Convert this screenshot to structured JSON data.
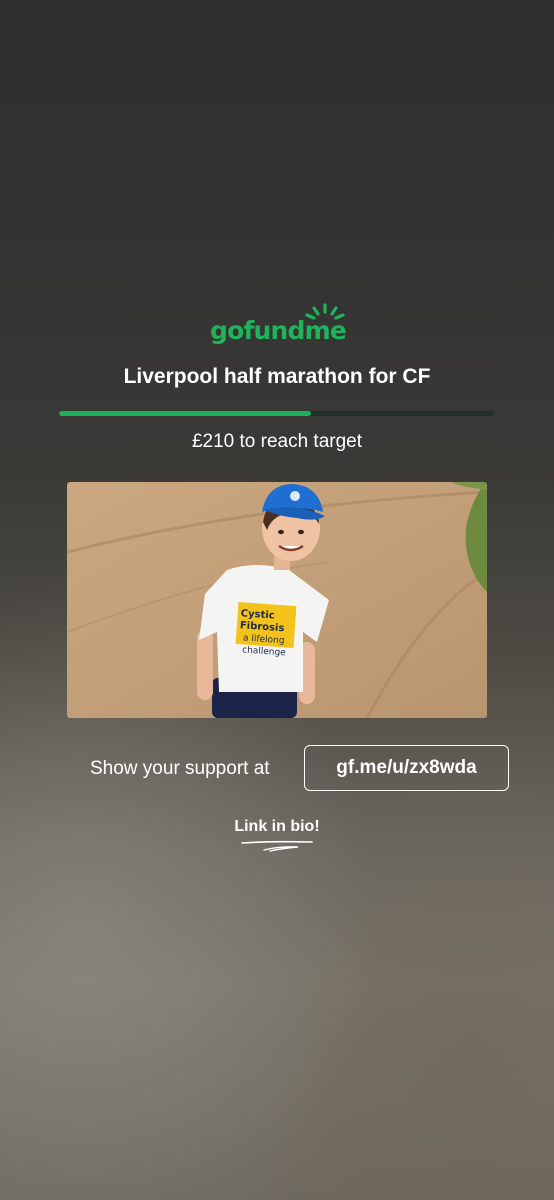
{
  "brand": {
    "logo_text": "gofundme",
    "color": "#1fb35b"
  },
  "fundraiser": {
    "title": "Liverpool half marathon for CF",
    "progress_percent": 58,
    "remaining_text": "£210 to reach target"
  },
  "photo": {
    "icon": "fundraiser-photo"
  },
  "support": {
    "label": "Show your support at",
    "link": "gf.me/u/zx8wda"
  },
  "link_in_bio": "Link in bio!",
  "colors": {
    "accent": "#19b15a",
    "text": "#ffffff"
  }
}
